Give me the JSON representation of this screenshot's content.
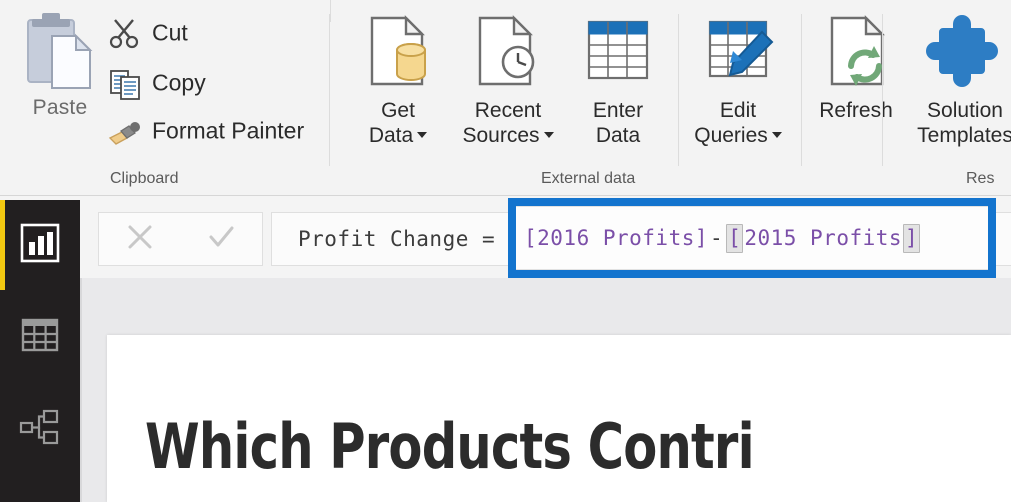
{
  "ribbon": {
    "groups": [
      {
        "name": "clipboard",
        "label": "Clipboard",
        "paste": {
          "label": "Paste",
          "icon": "paste-icon"
        },
        "items": [
          {
            "label": "Cut",
            "icon": "scissors-icon"
          },
          {
            "label": "Copy",
            "icon": "copy-icon"
          },
          {
            "label": "Format Painter",
            "icon": "format-painter-icon"
          }
        ]
      },
      {
        "name": "external-data",
        "label": "External data",
        "buttons": [
          {
            "label": "Get\nData",
            "icon": "get-data-icon",
            "has_caret": true
          },
          {
            "label": "Recent\nSources",
            "icon": "recent-sources-icon",
            "has_caret": true
          },
          {
            "label": "Enter\nData",
            "icon": "enter-data-icon",
            "has_caret": false
          },
          {
            "label": "Edit\nQueries",
            "icon": "edit-queries-icon",
            "has_caret": true
          },
          {
            "label": "Refresh",
            "icon": "refresh-icon",
            "has_caret": false
          }
        ]
      },
      {
        "name": "resources",
        "label": "Res",
        "buttons": [
          {
            "label": "Solution\nTemplates",
            "icon": "puzzle-piece-icon",
            "has_caret": false
          }
        ]
      }
    ]
  },
  "leftnav": {
    "items": [
      {
        "name": "report-view",
        "icon": "bar-chart-icon",
        "active": true
      },
      {
        "name": "data-view",
        "icon": "table-grid-icon",
        "active": false
      },
      {
        "name": "model-view",
        "icon": "relationships-icon",
        "active": false
      }
    ]
  },
  "formula_bar": {
    "cancel_icon": "close-x-icon",
    "commit_icon": "checkmark-icon",
    "measure_prefix": "Profit Change =",
    "expression": "[2016 Profits] - [2015 Profits]",
    "tokens": {
      "ref1": "[2016 Profits]",
      "operator": "-",
      "ref2_open": "[",
      "ref2_body": "2015 Profits",
      "ref2_close": "]"
    },
    "highlight_color": "#1374ce",
    "reference_color": "#7b4fa8"
  },
  "report": {
    "title": "Which Products Contri"
  },
  "colors": {
    "ribbon_bg": "#f3f3f3",
    "nav_bg": "#221f20",
    "accent_yellow": "#f2c811",
    "canvas_bg": "#e9e9eb",
    "blue": "#1374ce"
  }
}
